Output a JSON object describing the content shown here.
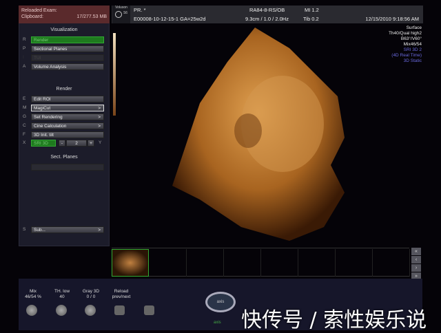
{
  "exam": {
    "label1": "Reloaded Exam:",
    "label2": "Clipboard:",
    "size": "17/277.53 MB"
  },
  "visualization": {
    "title": "Visualization",
    "items": [
      {
        "key": "R",
        "label": "Render"
      },
      {
        "key": "P",
        "label": "Sectional Planes"
      },
      {
        "key": "I",
        "label": "TUI"
      },
      {
        "key": "A",
        "label": "Volume Analysis"
      }
    ]
  },
  "render": {
    "title": "Render",
    "items": [
      {
        "key": "E",
        "label": "Edit ROI"
      },
      {
        "key": "M",
        "label": "MagiCut",
        "arrow": ">"
      },
      {
        "key": "G",
        "label": "Set Rendering",
        "arrow": ">"
      },
      {
        "key": "C",
        "label": "Cine Calculation",
        "arrow": ">"
      },
      {
        "key": "F",
        "label": "3D Init. tilt"
      }
    ],
    "sri": {
      "key": "X",
      "label": "SRI 3D",
      "minus": "-",
      "value": "2",
      "plus": "+",
      "key2": "Y"
    }
  },
  "sect": {
    "title": "Sect. Planes"
  },
  "sub": {
    "key": "S",
    "label": "Sub...",
    "arrow": ">"
  },
  "header": {
    "brand": "Voluson",
    "model": "S6",
    "patient": "PR.  *",
    "exam_id": "E00008-10-12-15-1  GA=25w2d",
    "probe": "RA84-8-RS/OB",
    "mi": "MI  1.2",
    "params": "9.3cm / 1.0 / 2.0Hz",
    "tib": "Tib  0.2",
    "datetime": "12/15/2010   9:18:56 AM"
  },
  "info": [
    "Surface",
    "Th40/Qual high2",
    "B63°/V60°",
    "Mix46/54"
  ],
  "info_blue": [
    "SRI 3D 2",
    "(4D Real Time)",
    "3D Static"
  ],
  "controls": [
    {
      "label": "Mix",
      "value": "46/54 %"
    },
    {
      "label": "TH. low",
      "value": "40"
    },
    {
      "label": "Gray 3D",
      "value": "0 / 0"
    },
    {
      "label": "Reload",
      "value": "prev/next"
    }
  ],
  "axis": {
    "center": "axis",
    "label": "axis"
  },
  "watermark": "快传号 / 索性娱乐说"
}
